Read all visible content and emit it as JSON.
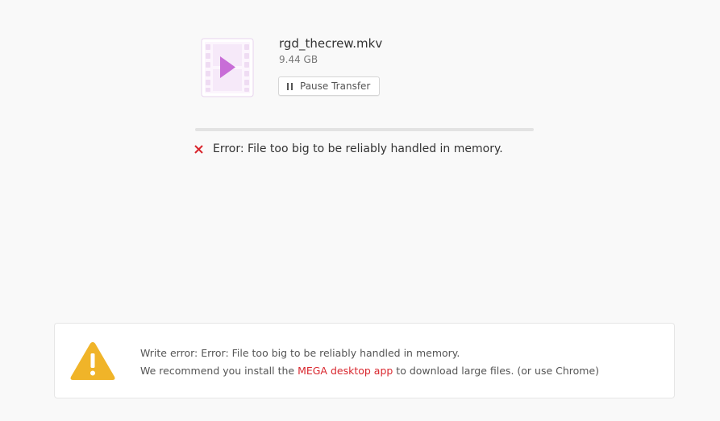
{
  "file": {
    "icon": "video-file-icon",
    "name": "rgd_thecrew.mkv",
    "size": "9.44 GB"
  },
  "transfer": {
    "pause_label": "Pause Transfer",
    "pause_icon": "pause-icon",
    "progress": 0
  },
  "error": {
    "icon": "close-icon",
    "text": "Error: File too big to be reliably handled in memory."
  },
  "warning": {
    "icon": "warning-icon",
    "line1": "Write error: Error: File too big to be reliably handled in memory.",
    "line2_prefix": "We recommend you install the ",
    "link_text": "MEGA desktop app",
    "line2_suffix": " to download large files. (or use Chrome)"
  },
  "colors": {
    "accent": "#d9272e",
    "video_icon": "#c86dd7",
    "warning": "#f0b429",
    "error": "#d9272e"
  }
}
